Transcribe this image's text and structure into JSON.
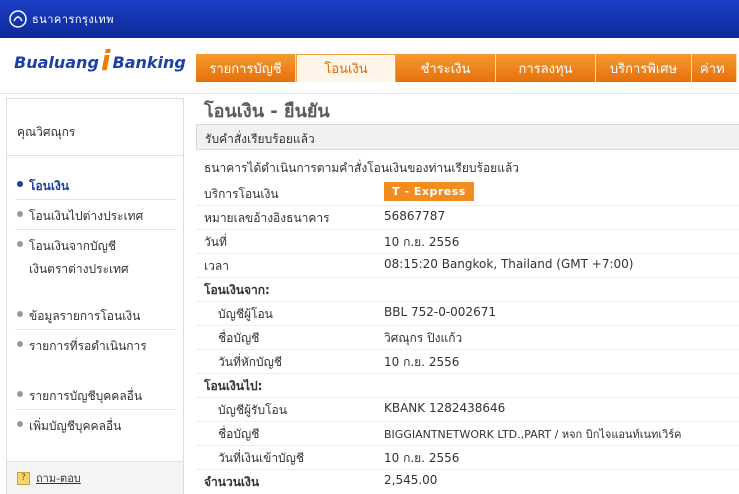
{
  "topbar": {
    "bank_name": "ธนาคารกรุงเทพ"
  },
  "logo": {
    "left": "Bualuang",
    "i": "i",
    "right": "Banking"
  },
  "tabs": [
    {
      "label": "รายการบัญชี"
    },
    {
      "label": "โอนเงิน"
    },
    {
      "label": "ชำระเงิน"
    },
    {
      "label": "การลงทุน"
    },
    {
      "label": "บริการพิเศษ"
    },
    {
      "label": "ค่าท"
    }
  ],
  "sidebar": {
    "user": "คุณวิศณุกร",
    "items": [
      {
        "label": "โอนเงิน"
      },
      {
        "label": "โอนเงินไปต่างประเทศ"
      },
      {
        "label": "โอนเงินจากบัญชี",
        "label2": "เงินตราต่างประเทศ"
      },
      {
        "label": "ข้อมูลรายการโอนเงิน"
      },
      {
        "label": "รายการที่รอดำเนินการ"
      },
      {
        "label": "รายการบัญชีบุคคลอื่น"
      },
      {
        "label": "เพิ่มบัญชีบุคคลอื่น"
      }
    ],
    "faq": "ถาม-ตอบ"
  },
  "main": {
    "title": "โอนเงิน - ยืนยัน",
    "confirm_bar": "รับคำสั่งเรียบร้อยแล้ว",
    "subtitle": "ธนาคารได้ดำเนินการตามคำสั่งโอนเงินของท่านเรียบร้อยแล้ว",
    "service_label": "บริการโอนเงิน",
    "service_value": "T - Express",
    "ref_label": "หมายเลขอ้างอิงธนาคาร",
    "ref_value": "56867787",
    "date_label": "วันที่",
    "date_value": "10 ก.ย. 2556",
    "time_label": "เวลา",
    "time_value": "08:15:20 Bangkok, Thailand (GMT +7:00)",
    "from_label": "โอนเงินจาก:",
    "from_account_label": "บัญชีผู้โอน",
    "from_account_value": "BBL 752-0-002671",
    "from_name_label": "ชื่อบัญชี",
    "from_name_value": "วิศณุกร ปิงแก้ว",
    "debit_date_label": "วันที่หักบัญชี",
    "debit_date_value": "10 ก.ย. 2556",
    "to_label": "โอนเงินไป:",
    "to_account_label": "บัญชีผู้รับโอน",
    "to_account_value": "KBANK 1282438646",
    "to_name_label": "ชื่อบัญชี",
    "to_name_value": "BIGGIANTNETWORK LTD.,PART / หจก บิกไจแอนท์เนทเวิร์ค",
    "credit_date_label": "วันที่เงินเข้าบัญชี",
    "credit_date_value": "10 ก.ย. 2556",
    "amount_label": "จำนวนเงิน",
    "amount_value": "2,545.00"
  }
}
